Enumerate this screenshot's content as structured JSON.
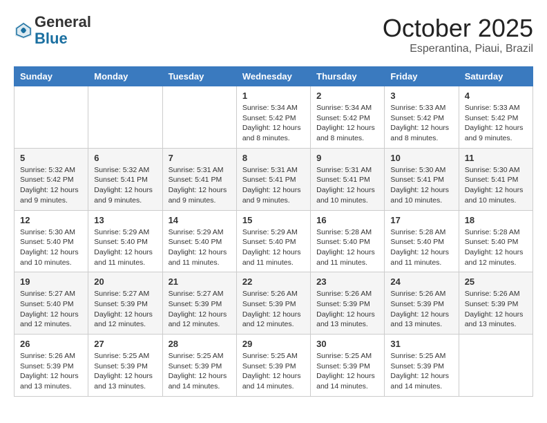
{
  "header": {
    "logo_general": "General",
    "logo_blue": "Blue",
    "month": "October 2025",
    "location": "Esperantina, Piaui, Brazil"
  },
  "weekdays": [
    "Sunday",
    "Monday",
    "Tuesday",
    "Wednesday",
    "Thursday",
    "Friday",
    "Saturday"
  ],
  "weeks": [
    [
      {
        "day": "",
        "info": ""
      },
      {
        "day": "",
        "info": ""
      },
      {
        "day": "",
        "info": ""
      },
      {
        "day": "1",
        "info": "Sunrise: 5:34 AM\nSunset: 5:42 PM\nDaylight: 12 hours and 8 minutes."
      },
      {
        "day": "2",
        "info": "Sunrise: 5:34 AM\nSunset: 5:42 PM\nDaylight: 12 hours and 8 minutes."
      },
      {
        "day": "3",
        "info": "Sunrise: 5:33 AM\nSunset: 5:42 PM\nDaylight: 12 hours and 8 minutes."
      },
      {
        "day": "4",
        "info": "Sunrise: 5:33 AM\nSunset: 5:42 PM\nDaylight: 12 hours and 9 minutes."
      }
    ],
    [
      {
        "day": "5",
        "info": "Sunrise: 5:32 AM\nSunset: 5:42 PM\nDaylight: 12 hours and 9 minutes."
      },
      {
        "day": "6",
        "info": "Sunrise: 5:32 AM\nSunset: 5:41 PM\nDaylight: 12 hours and 9 minutes."
      },
      {
        "day": "7",
        "info": "Sunrise: 5:31 AM\nSunset: 5:41 PM\nDaylight: 12 hours and 9 minutes."
      },
      {
        "day": "8",
        "info": "Sunrise: 5:31 AM\nSunset: 5:41 PM\nDaylight: 12 hours and 9 minutes."
      },
      {
        "day": "9",
        "info": "Sunrise: 5:31 AM\nSunset: 5:41 PM\nDaylight: 12 hours and 10 minutes."
      },
      {
        "day": "10",
        "info": "Sunrise: 5:30 AM\nSunset: 5:41 PM\nDaylight: 12 hours and 10 minutes."
      },
      {
        "day": "11",
        "info": "Sunrise: 5:30 AM\nSunset: 5:41 PM\nDaylight: 12 hours and 10 minutes."
      }
    ],
    [
      {
        "day": "12",
        "info": "Sunrise: 5:30 AM\nSunset: 5:40 PM\nDaylight: 12 hours and 10 minutes."
      },
      {
        "day": "13",
        "info": "Sunrise: 5:29 AM\nSunset: 5:40 PM\nDaylight: 12 hours and 11 minutes."
      },
      {
        "day": "14",
        "info": "Sunrise: 5:29 AM\nSunset: 5:40 PM\nDaylight: 12 hours and 11 minutes."
      },
      {
        "day": "15",
        "info": "Sunrise: 5:29 AM\nSunset: 5:40 PM\nDaylight: 12 hours and 11 minutes."
      },
      {
        "day": "16",
        "info": "Sunrise: 5:28 AM\nSunset: 5:40 PM\nDaylight: 12 hours and 11 minutes."
      },
      {
        "day": "17",
        "info": "Sunrise: 5:28 AM\nSunset: 5:40 PM\nDaylight: 12 hours and 11 minutes."
      },
      {
        "day": "18",
        "info": "Sunrise: 5:28 AM\nSunset: 5:40 PM\nDaylight: 12 hours and 12 minutes."
      }
    ],
    [
      {
        "day": "19",
        "info": "Sunrise: 5:27 AM\nSunset: 5:40 PM\nDaylight: 12 hours and 12 minutes."
      },
      {
        "day": "20",
        "info": "Sunrise: 5:27 AM\nSunset: 5:39 PM\nDaylight: 12 hours and 12 minutes."
      },
      {
        "day": "21",
        "info": "Sunrise: 5:27 AM\nSunset: 5:39 PM\nDaylight: 12 hours and 12 minutes."
      },
      {
        "day": "22",
        "info": "Sunrise: 5:26 AM\nSunset: 5:39 PM\nDaylight: 12 hours and 12 minutes."
      },
      {
        "day": "23",
        "info": "Sunrise: 5:26 AM\nSunset: 5:39 PM\nDaylight: 12 hours and 13 minutes."
      },
      {
        "day": "24",
        "info": "Sunrise: 5:26 AM\nSunset: 5:39 PM\nDaylight: 12 hours and 13 minutes."
      },
      {
        "day": "25",
        "info": "Sunrise: 5:26 AM\nSunset: 5:39 PM\nDaylight: 12 hours and 13 minutes."
      }
    ],
    [
      {
        "day": "26",
        "info": "Sunrise: 5:26 AM\nSunset: 5:39 PM\nDaylight: 12 hours and 13 minutes."
      },
      {
        "day": "27",
        "info": "Sunrise: 5:25 AM\nSunset: 5:39 PM\nDaylight: 12 hours and 13 minutes."
      },
      {
        "day": "28",
        "info": "Sunrise: 5:25 AM\nSunset: 5:39 PM\nDaylight: 12 hours and 14 minutes."
      },
      {
        "day": "29",
        "info": "Sunrise: 5:25 AM\nSunset: 5:39 PM\nDaylight: 12 hours and 14 minutes."
      },
      {
        "day": "30",
        "info": "Sunrise: 5:25 AM\nSunset: 5:39 PM\nDaylight: 12 hours and 14 minutes."
      },
      {
        "day": "31",
        "info": "Sunrise: 5:25 AM\nSunset: 5:39 PM\nDaylight: 12 hours and 14 minutes."
      },
      {
        "day": "",
        "info": ""
      }
    ]
  ]
}
